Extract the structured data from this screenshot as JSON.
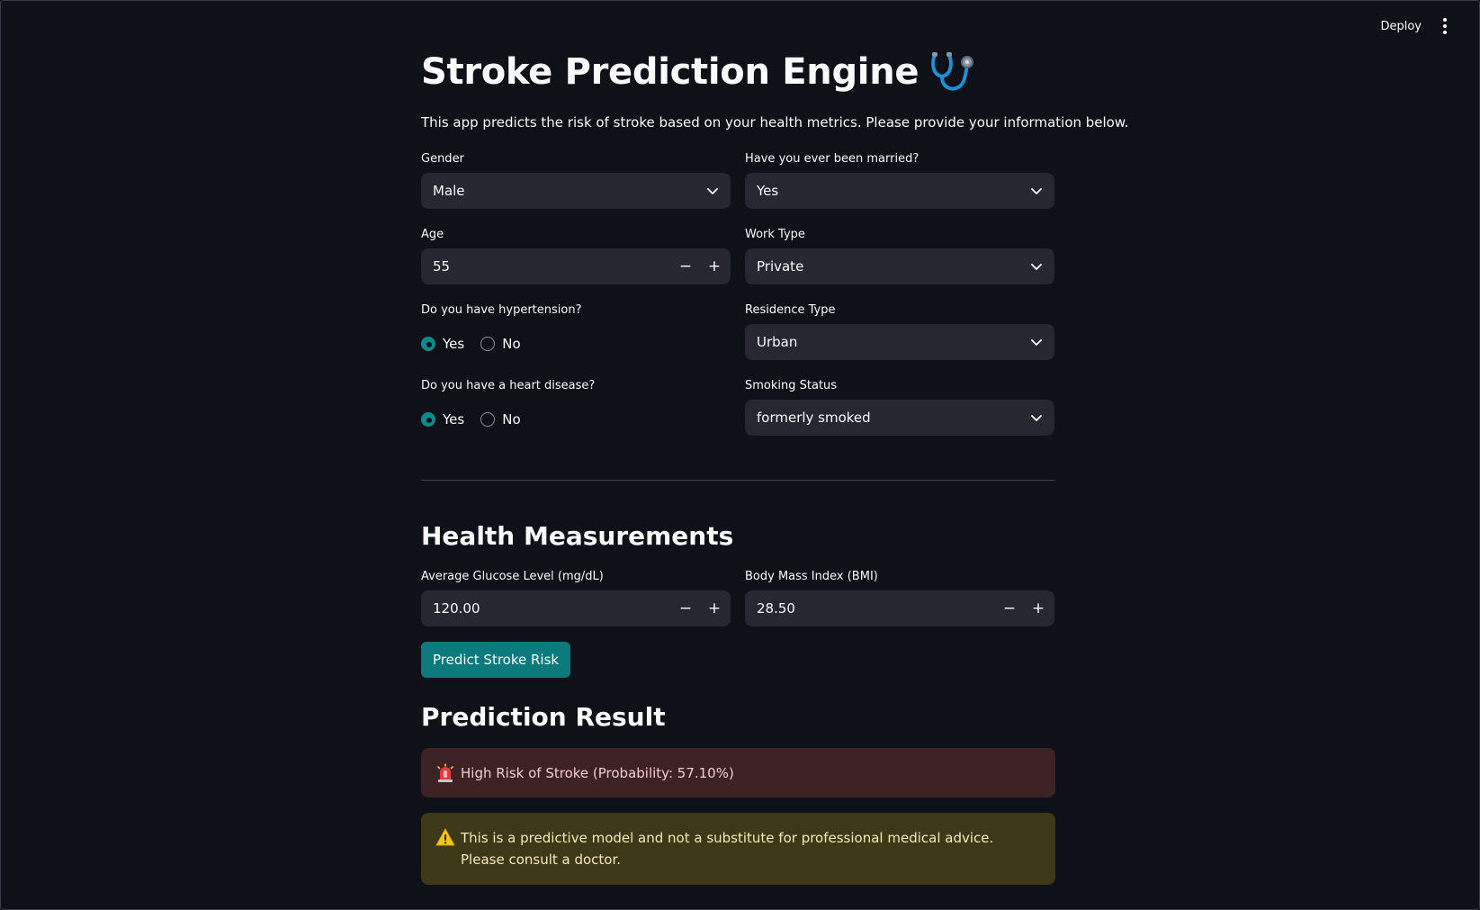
{
  "topbar": {
    "deploy_label": "Deploy"
  },
  "header": {
    "title": "Stroke Prediction Engine",
    "description": "This app predicts the risk of stroke based on your health metrics. Please provide your information below."
  },
  "form": {
    "gender": {
      "label": "Gender",
      "value": "Male"
    },
    "married": {
      "label": "Have you ever been married?",
      "value": "Yes"
    },
    "age": {
      "label": "Age",
      "value": "55"
    },
    "work_type": {
      "label": "Work Type",
      "value": "Private"
    },
    "hypertension": {
      "label": "Do you have hypertension?",
      "options": [
        "Yes",
        "No"
      ],
      "selected": "Yes"
    },
    "residence": {
      "label": "Residence Type",
      "value": "Urban"
    },
    "heart_disease": {
      "label": "Do you have a heart disease?",
      "options": [
        "Yes",
        "No"
      ],
      "selected": "Yes"
    },
    "smoking": {
      "label": "Smoking Status",
      "value": "formerly smoked"
    }
  },
  "health": {
    "heading": "Health Measurements",
    "glucose": {
      "label": "Average Glucose Level (mg/dL)",
      "value": "120.00"
    },
    "bmi": {
      "label": "Body Mass Index (BMI)",
      "value": "28.50"
    },
    "predict_label": "Predict Stroke Risk"
  },
  "result": {
    "heading": "Prediction Result",
    "error_text": "High Risk of Stroke (Probability: 57.10%)",
    "warning_text": "This is a predictive model and not a substitute for professional medical advice. Please consult a doctor."
  },
  "colors": {
    "background": "#0e1117",
    "input_bg": "#262730",
    "accent": "#0c7a7c",
    "error_bg": "#3c2125",
    "warning_bg": "#3d3817"
  }
}
